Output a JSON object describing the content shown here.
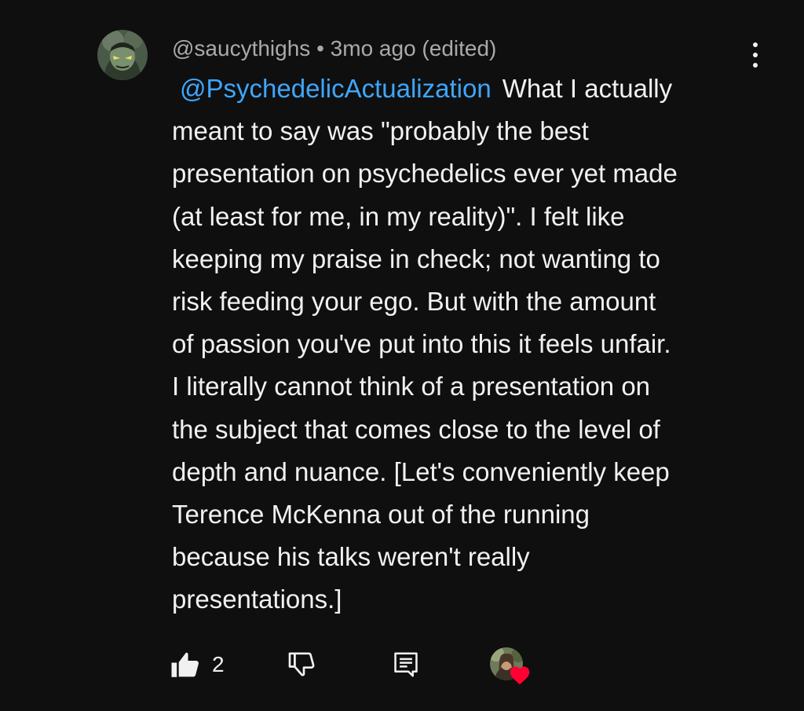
{
  "comment": {
    "author_handle": "@saucythighs",
    "separator": " • ",
    "time_ago": "3mo ago (edited)",
    "mention": "@PsychedelicActualization",
    "body_lines": [
      "What I actually",
      "meant to say was \"probably the best",
      "presentation on psychedelics ever yet made",
      "(at least for me, in my reality)\". I felt like",
      "keeping my praise in check; not wanting to",
      "risk feeding your ego. But with the amount",
      "of passion you've put into this it feels unfair.",
      "I literally cannot think of a presentation on",
      "the subject that comes close to the level of",
      "depth and nuance. [Let's conveniently keep",
      "Terence McKenna out of the running",
      "because his talks weren't really",
      "presentations.]"
    ]
  },
  "actions": {
    "like_count": "2",
    "icons": {
      "like": "thumb-up-icon",
      "dislike": "thumb-down-icon",
      "reply": "reply-comment-icon",
      "heart": "heart-icon",
      "menu": "more-vert-icon"
    }
  },
  "colors": {
    "background": "#0f0f0f",
    "text": "#f1f1f1",
    "secondary_text": "#aaaaaa",
    "mention_link": "#3ea6ff",
    "heart": "#ff0033"
  }
}
